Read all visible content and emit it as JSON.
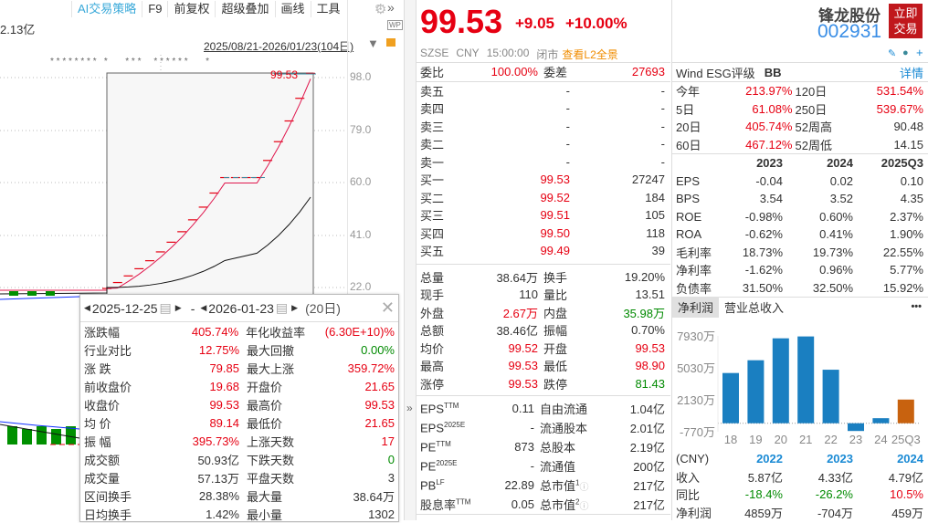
{
  "toolbar": {
    "items": [
      "AI交易策略",
      "F9",
      "前复权",
      "超级叠加",
      "画线",
      "工具"
    ]
  },
  "left": {
    "amount": "2.13亿",
    "date_range": "2025/08/21-2026/01/23(104日)",
    "axis": [
      "98.0",
      "79.0",
      "60.0",
      "41.0",
      "22.0"
    ],
    "last_label": "99.53",
    "stars": "* * * * * * * *   *       * * *     * * * * * *       *",
    "closes": [
      21.65,
      23.8,
      26.2,
      28.8,
      31.7,
      34.9,
      38.4,
      42.2,
      46.5,
      51.1,
      56.2,
      61.8,
      61.8,
      61.8,
      61.8,
      68.0,
      74.8,
      82.3,
      90.5,
      99.53
    ]
  },
  "popup": {
    "start": "2025-12-25",
    "dash": "-",
    "end": "2026-01-23",
    "days": "(20日)",
    "rows": [
      [
        "涨跌幅",
        "405.74%",
        "red",
        "年化收益率",
        "(6.30E+10)%",
        "red"
      ],
      [
        "行业对比",
        "12.75%",
        "red",
        "最大回撤",
        "0.00%",
        "green"
      ],
      [
        "涨  跌",
        "79.85",
        "red",
        "最大上涨",
        "359.72%",
        "red"
      ],
      [
        "前收盘价",
        "19.68",
        "red",
        "开盘价",
        "21.65",
        "red"
      ],
      [
        "收盘价",
        "99.53",
        "red",
        "最高价",
        "99.53",
        "red"
      ],
      [
        "均  价",
        "89.14",
        "red",
        "最低价",
        "21.65",
        "red"
      ],
      [
        "振  幅",
        "395.73%",
        "red",
        "上涨天数",
        "17",
        "red"
      ],
      [
        "成交额",
        "50.93亿",
        "",
        "下跌天数",
        "0",
        "green"
      ],
      [
        "成交量",
        "57.13万",
        "",
        "平盘天数",
        "3",
        ""
      ],
      [
        "区间换手",
        "28.38%",
        "",
        "最大量",
        "38.64万",
        ""
      ],
      [
        "日均换手",
        "1.42%",
        "",
        "最小量",
        "1302",
        ""
      ]
    ]
  },
  "quote": {
    "price": "99.53",
    "change": "+9.05",
    "pct": "+10.00%",
    "exchange": "SZSE",
    "currency": "CNY",
    "time": "15:00:00",
    "status": "闭市",
    "l2": "查看L2全景",
    "rows": [
      [
        "委比",
        "100.00%",
        "red",
        "委差",
        "27693",
        "red"
      ]
    ],
    "book": [
      [
        "卖五",
        "-",
        "-"
      ],
      [
        "卖四",
        "-",
        "-"
      ],
      [
        "卖三",
        "-",
        "-"
      ],
      [
        "卖二",
        "-",
        "-"
      ],
      [
        "卖一",
        "-",
        "-"
      ],
      [
        "买一",
        "99.53",
        "27247"
      ],
      [
        "买二",
        "99.52",
        "184"
      ],
      [
        "买三",
        "99.51",
        "105"
      ],
      [
        "买四",
        "99.50",
        "118"
      ],
      [
        "买五",
        "99.49",
        "39"
      ]
    ],
    "stats": [
      [
        "总量",
        "38.64万",
        "",
        "换手",
        "19.20%",
        ""
      ],
      [
        "现手",
        "110",
        "",
        "量比",
        "13.51",
        ""
      ],
      [
        "外盘",
        "2.67万",
        "red",
        "内盘",
        "35.98万",
        "green"
      ],
      [
        "总额",
        "38.46亿",
        "",
        "振幅",
        "0.70%",
        ""
      ],
      [
        "均价",
        "99.52",
        "red",
        "开盘",
        "99.53",
        "red"
      ],
      [
        "最高",
        "99.53",
        "red",
        "最低",
        "98.90",
        "red"
      ],
      [
        "涨停",
        "99.53",
        "red",
        "跌停",
        "81.43",
        "green"
      ]
    ],
    "fund": [
      [
        "EPS",
        "TTM",
        "0.11",
        "自由流通",
        "",
        "1.04亿"
      ],
      [
        "EPS",
        "2025E",
        "-",
        "流通股本",
        "",
        "2.01亿"
      ],
      [
        "PE",
        "TTM",
        "873",
        "总股本",
        "",
        "2.19亿"
      ],
      [
        "PE",
        "2025E",
        "-",
        "流通值",
        "",
        "200亿"
      ],
      [
        "PB",
        "LF",
        "22.89",
        "总市值",
        "1",
        "217亿"
      ],
      [
        "股息率",
        "TTM",
        "0.05",
        "总市值",
        "2",
        "217亿"
      ]
    ]
  },
  "stock": {
    "name": "锋龙股份",
    "code": "002931",
    "trade_btn": "立即交易"
  },
  "right": {
    "esg_label": "Wind  ESG评级",
    "esg": "BB",
    "detail": "详情",
    "perf": [
      [
        "今年",
        "213.97%",
        "120日",
        "531.54%"
      ],
      [
        "5日",
        "61.08%",
        "250日",
        "539.67%"
      ],
      [
        "20日",
        "405.74%",
        "52周高",
        "90.48"
      ],
      [
        "60日",
        "467.12%",
        "52周低",
        "14.15"
      ]
    ],
    "fin_head": [
      "2023",
      "2024",
      "2025Q3"
    ],
    "fin": [
      [
        "EPS",
        "-0.04",
        "0.02",
        "0.10"
      ],
      [
        "BPS",
        "3.54",
        "3.52",
        "4.35"
      ],
      [
        "ROE",
        "-0.98%",
        "0.60%",
        "2.37%"
      ],
      [
        "ROA",
        "-0.62%",
        "0.41%",
        "1.90%"
      ],
      [
        "毛利率",
        "18.73%",
        "19.73%",
        "22.55%"
      ],
      [
        "净利率",
        "-1.62%",
        "0.96%",
        "5.77%"
      ],
      [
        "负债率",
        "31.50%",
        "32.50%",
        "15.92%"
      ]
    ],
    "tabs": [
      "净利润",
      "营业总收入"
    ],
    "more": "•••",
    "bottom_head": [
      "(CNY)",
      "2022",
      "2023",
      "2024"
    ],
    "bottom": [
      [
        "收入",
        "5.87亿",
        "",
        "4.33亿",
        "",
        "4.79亿",
        ""
      ],
      [
        "同比",
        "-18.4%",
        "green",
        "-26.2%",
        "green",
        "10.5%",
        "red"
      ],
      [
        "净利润",
        "4859万",
        "",
        "-704万",
        "",
        "459万",
        ""
      ]
    ]
  },
  "chart_data": {
    "type": "bar",
    "title": "净利润",
    "categories": [
      "18",
      "19",
      "20",
      "21",
      "22",
      "23",
      "24",
      "25Q3"
    ],
    "values": [
      4560,
      5720,
      7710,
      7880,
      4859,
      -704,
      459,
      2150
    ],
    "unit": "万",
    "yticks": [
      "7930万",
      "5030万",
      "2130万",
      "-770万"
    ],
    "ylim": [
      -770,
      7930
    ],
    "colors": [
      "#1a7fc1",
      "#1a7fc1",
      "#1a7fc1",
      "#1a7fc1",
      "#1a7fc1",
      "#1a7fc1",
      "#1a7fc1",
      "#c8620f"
    ]
  }
}
